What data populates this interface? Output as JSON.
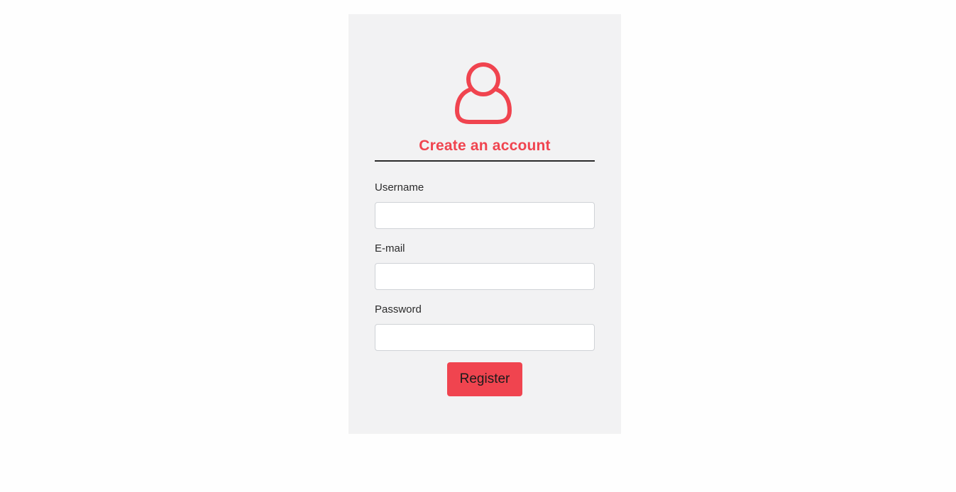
{
  "colors": {
    "accent": "#f0444f",
    "card_background": "#f2f2f3",
    "page_background": "#fefefe"
  },
  "form": {
    "icon": "user-icon",
    "title": "Create an account",
    "fields": [
      {
        "label": "Username",
        "value": "",
        "placeholder": ""
      },
      {
        "label": "E-mail",
        "value": "",
        "placeholder": ""
      },
      {
        "label": "Password",
        "value": "",
        "placeholder": ""
      }
    ],
    "submit_label": "Register"
  }
}
